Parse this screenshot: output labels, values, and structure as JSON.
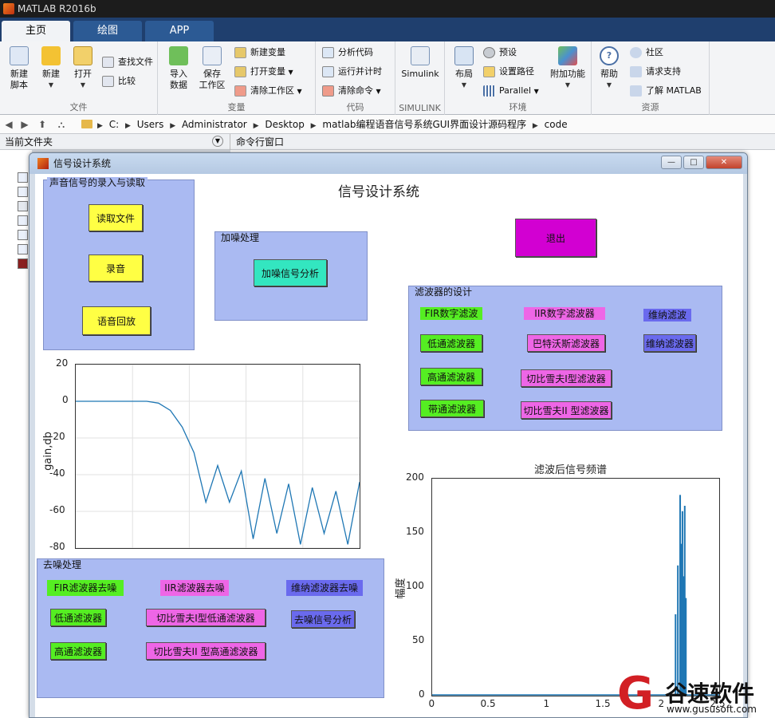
{
  "app": {
    "title": "MATLAB R2016b"
  },
  "tabs": [
    {
      "label": "主页"
    },
    {
      "label": "绘图"
    },
    {
      "label": "APP"
    }
  ],
  "ribbon": {
    "file": {
      "group_title": "文件",
      "new_script": "新建\n脚本",
      "new": "新建",
      "open": "打开",
      "find_files": "查找文件",
      "compare": "比较"
    },
    "variable": {
      "group_title": "变量",
      "import_data": "导入\n数据",
      "save_workspace": "保存\n工作区",
      "new_variable": "新建变量",
      "open_variable": "打开变量",
      "clear_workspace": "清除工作区"
    },
    "code": {
      "group_title": "代码",
      "analyze_code": "分析代码",
      "run_and_time": "运行并计时",
      "clear_commands": "清除命令"
    },
    "simulink": {
      "group_title": "SIMULINK",
      "simulink": "Simulink"
    },
    "environment": {
      "group_title": "环境",
      "layout": "布局",
      "preferences": "预设",
      "set_path": "设置路径",
      "parallel": "Parallel",
      "addons": "附加功能"
    },
    "resources": {
      "group_title": "资源",
      "help": "帮助",
      "community": "社区",
      "request_support": "请求支持",
      "learn_matlab": "了解 MATLAB"
    }
  },
  "address": {
    "crumbs": [
      "C:",
      "Users",
      "Administrator",
      "Desktop",
      "matlab编程语音信号系统GUI界面设计源码程序",
      "code"
    ]
  },
  "panels": {
    "current_folder": "当前文件夹",
    "command_window": "命令行窗口"
  },
  "figure": {
    "window_title": "信号设计系统",
    "main_title": "信号设计系统",
    "record_panel": {
      "title": "声音信号的录入与读取",
      "read_file": "读取文件",
      "record": "录音",
      "playback": "语音回放"
    },
    "noise_panel": {
      "title": "加噪处理",
      "analyze": "加噪信号分析"
    },
    "exit_button": "退出",
    "filter_panel": {
      "title": "滤波器的设计",
      "fir_label": "FIR数字滤波",
      "iir_label": "IIR数字滤波器",
      "wiener_label": "维纳滤波",
      "lowpass": "低通滤波器",
      "highpass": "高通滤波器",
      "bandpass": "带通滤波器",
      "butterworth": "巴特沃斯滤波器",
      "cheby1": "切比雪夫Ⅰ型滤波器",
      "cheby2": "切比雪夫II 型滤波器",
      "wiener_filter": "维纳滤波器"
    },
    "denoise_panel": {
      "title": "去噪处理",
      "fir_denoise": "FIR滤波器去噪",
      "iir_denoise": "IIR滤波器去噪",
      "wiener_denoise": "维纳滤波器去噪",
      "lowpass": "低通滤波器",
      "highpass": "高通滤波器",
      "cheby1_low": "切比雪夫Ⅰ型低通滤波器",
      "cheby2_high": "切比雪夫II 型高通滤波器",
      "analyze": "去噪信号分析"
    },
    "colors": {
      "panel_bg": "#aabaf2",
      "yellow": "#ffff44",
      "cyan": "#33e6c0",
      "magenta": "#d200d2",
      "green": "#55ee22",
      "pink": "#ee66e6",
      "purple": "#6a6aee",
      "line": "#1f77b4"
    }
  },
  "chart_data": [
    {
      "type": "line",
      "title": "",
      "xlabel": "",
      "ylabel": "gain,db",
      "ylim": [
        -80,
        20
      ],
      "yticks": [
        "20",
        "0",
        "-20",
        "-40",
        "-60",
        "-80"
      ],
      "grid": true,
      "series": [
        {
          "values": [
            0,
            0,
            0,
            0,
            0,
            0,
            0,
            -1,
            -5,
            -14,
            -28,
            -55,
            -35,
            -55,
            -38,
            -75,
            -42,
            -72,
            -45,
            -78,
            -47,
            -72,
            -49,
            -78,
            -44
          ]
        }
      ]
    },
    {
      "type": "line",
      "title": "滤波后信号频谱",
      "xlabel": "",
      "ylabel": "幅度",
      "xlim": [
        0,
        2.5
      ],
      "ylim": [
        0,
        200
      ],
      "xticks": [
        "0",
        "0.5",
        "1",
        "1.5",
        "2",
        "2.5"
      ],
      "yticks": [
        "200",
        "150",
        "100",
        "50",
        "0"
      ],
      "grid": false,
      "peaks": [
        {
          "x": 2.12,
          "y": 75
        },
        {
          "x": 2.14,
          "y": 120
        },
        {
          "x": 2.16,
          "y": 185
        },
        {
          "x": 2.17,
          "y": 140
        },
        {
          "x": 2.18,
          "y": 170
        },
        {
          "x": 2.19,
          "y": 110
        },
        {
          "x": 2.2,
          "y": 175
        },
        {
          "x": 2.21,
          "y": 90
        }
      ]
    }
  ],
  "watermark": {
    "logo": "G",
    "text": "谷速软件",
    "url": "www.gususoft.com"
  }
}
